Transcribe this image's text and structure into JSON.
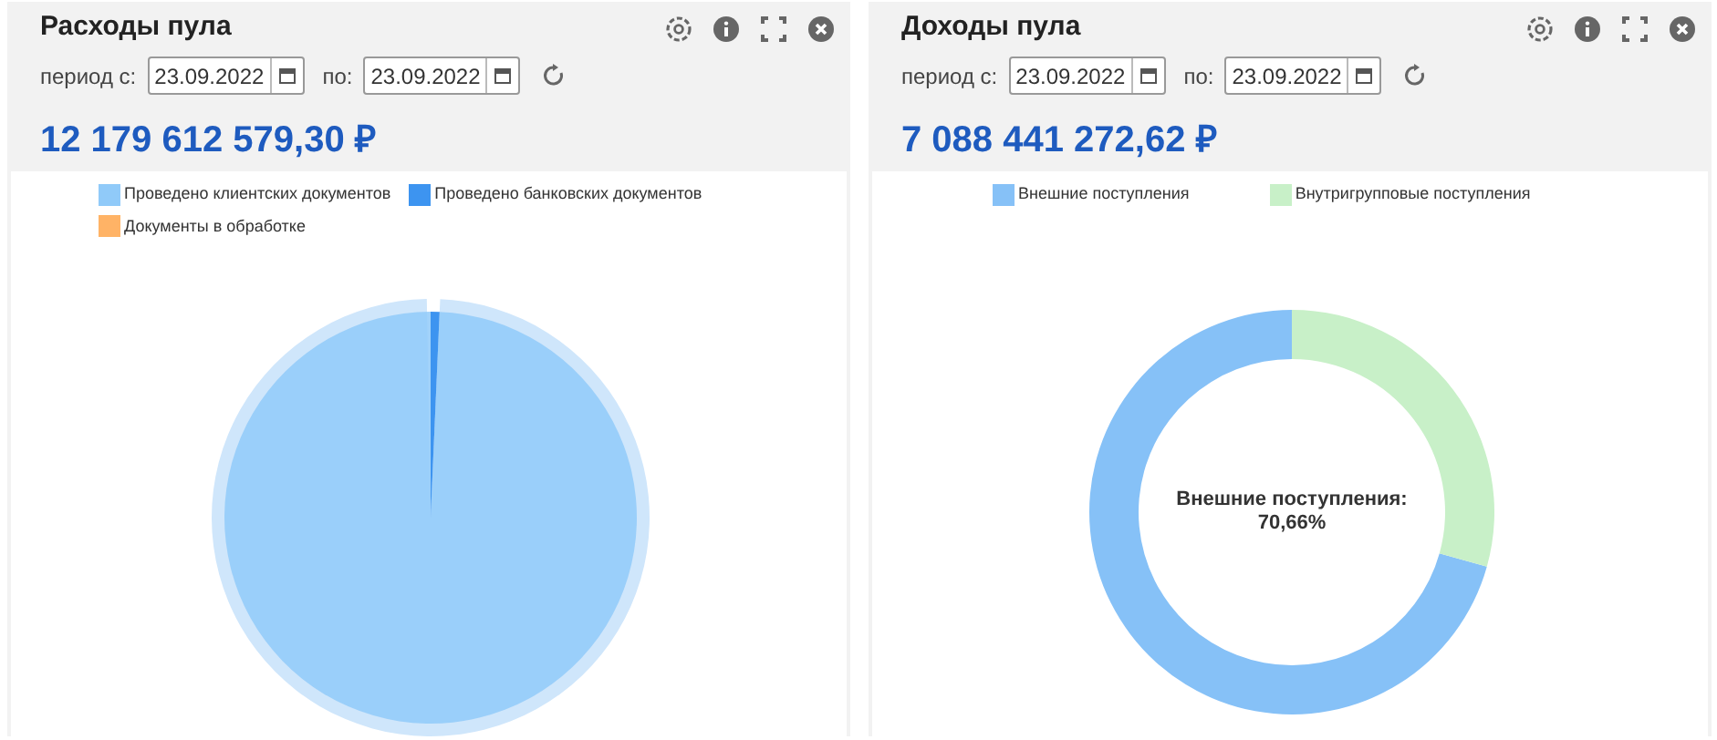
{
  "panels": [
    {
      "title": "Расходы пула",
      "period_from_label": "период с:",
      "date_from": "23.09.2022",
      "period_to_label": "по:",
      "date_to": "23.09.2022",
      "total": "12 179 612 579,30 ₽",
      "kind": "pie",
      "legend": [
        {
          "label": "Проведено клиентских документов",
          "color": "#90caf9"
        },
        {
          "label": "Проведено банковских документов",
          "color": "#3d94f0"
        },
        {
          "label": "Документы в обработке",
          "color": "#ffb366"
        }
      ]
    },
    {
      "title": "Доходы пула",
      "period_from_label": "период с:",
      "date_from": "23.09.2022",
      "period_to_label": "по:",
      "date_to": "23.09.2022",
      "total": "7 088 441 272,62 ₽",
      "kind": "donut",
      "legend": [
        {
          "color": "#86c1f7"
        },
        {
          "color": "#c8f0c8"
        }
      ],
      "center_label": "Внешние поступления: 70,66%",
      "chart_data": {
        "type": "donut",
        "categories": [
          "Внешние поступления",
          "Внутригрупповые поступления"
        ],
        "values": [
          70.66,
          29.34
        ]
      }
    }
  ]
}
